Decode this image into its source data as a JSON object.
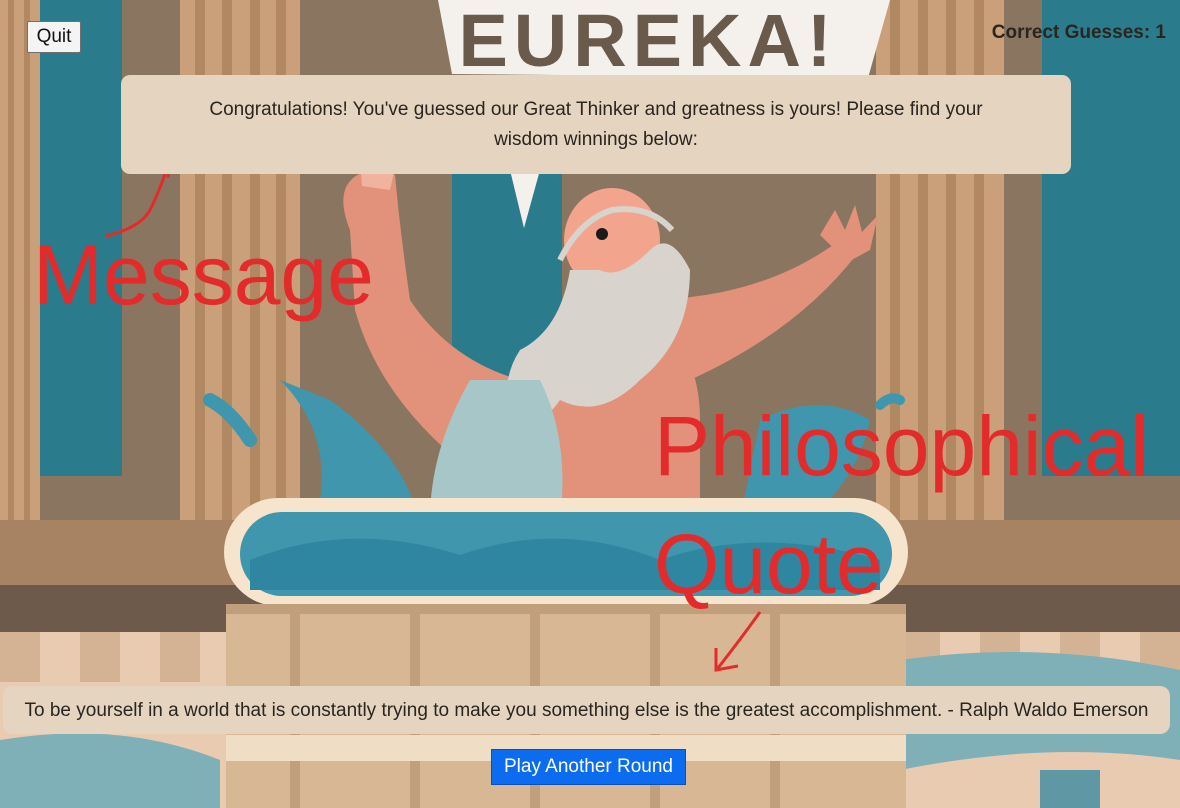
{
  "game": {
    "logo_text": "EUREKA!",
    "quit_label": "Quit",
    "score_label": "Correct Guesses:",
    "score_value": 1,
    "score_text": "Correct Guesses: 1",
    "message": "Congratulations! You've guessed our Great Thinker and greatness is yours! Please find your wisdom winnings below:",
    "quote": "To be yourself in a world that is constantly trying to make you something else is the greatest accomplishment. - Ralph Waldo Emerson",
    "play_again_label": "Play Another Round"
  },
  "annotations": {
    "message": "Message",
    "quote_line1": "Philosophical",
    "quote_line2": "Quote"
  },
  "colors": {
    "annotation_red": "#e32b2b",
    "panel_beige": "#e5d5c0",
    "button_blue": "#0b6cf0",
    "wall_teal": "#2a7c8c",
    "water_blue": "#3f96ad"
  }
}
